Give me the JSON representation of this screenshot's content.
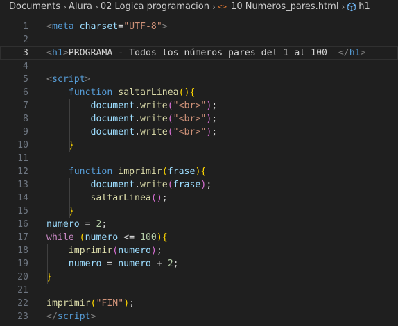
{
  "breadcrumb": {
    "items": [
      "Documents",
      "Alura",
      "02 Logica programacion"
    ],
    "file_icon": "<>",
    "file_name": "10 Numeros_pares.html",
    "symbol_icon": "cube-icon",
    "symbol_name": "h1"
  },
  "editor": {
    "current_line": 3,
    "lines": [
      {
        "n": "1",
        "tokens": [
          [
            "tag",
            "<"
          ],
          [
            "tagname",
            "meta"
          ],
          [
            "plain",
            " "
          ],
          [
            "attr",
            "charset"
          ],
          [
            "plain",
            "="
          ],
          [
            "str",
            "\"UTF-8\""
          ],
          [
            "tag",
            ">"
          ]
        ]
      },
      {
        "n": "2",
        "tokens": []
      },
      {
        "n": "3",
        "tokens": [
          [
            "tag",
            "<"
          ],
          [
            "tagname",
            "h1"
          ],
          [
            "tag",
            ">"
          ],
          [
            "text",
            "PROGRAMA - Todos los números pares del 1 al 100  "
          ],
          [
            "tag",
            "</"
          ],
          [
            "tagname",
            "h1"
          ],
          [
            "tag",
            ">"
          ]
        ]
      },
      {
        "n": "4",
        "tokens": []
      },
      {
        "n": "5",
        "tokens": [
          [
            "tag",
            "<"
          ],
          [
            "tagname",
            "script"
          ],
          [
            "tag",
            ">"
          ]
        ]
      },
      {
        "n": "6",
        "tokens": [
          [
            "plain",
            "    "
          ],
          [
            "kw",
            "function"
          ],
          [
            "plain",
            " "
          ],
          [
            "fn",
            "saltarLinea"
          ],
          [
            "br1",
            "()"
          ],
          [
            "br1",
            "{"
          ]
        ]
      },
      {
        "n": "7",
        "tokens": [
          [
            "plain",
            "        "
          ],
          [
            "var",
            "document"
          ],
          [
            "plain",
            "."
          ],
          [
            "fn",
            "write"
          ],
          [
            "br2",
            "("
          ],
          [
            "str",
            "\"<br>\""
          ],
          [
            "br2",
            ")"
          ],
          [
            "plain",
            ";"
          ]
        ]
      },
      {
        "n": "8",
        "tokens": [
          [
            "plain",
            "        "
          ],
          [
            "var",
            "document"
          ],
          [
            "plain",
            "."
          ],
          [
            "fn",
            "write"
          ],
          [
            "br2",
            "("
          ],
          [
            "str",
            "\"<br>\""
          ],
          [
            "br2",
            ")"
          ],
          [
            "plain",
            ";"
          ]
        ]
      },
      {
        "n": "9",
        "tokens": [
          [
            "plain",
            "        "
          ],
          [
            "var",
            "document"
          ],
          [
            "plain",
            "."
          ],
          [
            "fn",
            "write"
          ],
          [
            "br2",
            "("
          ],
          [
            "str",
            "\"<br>\""
          ],
          [
            "br2",
            ")"
          ],
          [
            "plain",
            ";"
          ]
        ]
      },
      {
        "n": "10",
        "tokens": [
          [
            "plain",
            "    "
          ],
          [
            "br1",
            "}"
          ]
        ]
      },
      {
        "n": "11",
        "tokens": []
      },
      {
        "n": "12",
        "tokens": [
          [
            "plain",
            "    "
          ],
          [
            "kw",
            "function"
          ],
          [
            "plain",
            " "
          ],
          [
            "fn",
            "imprimir"
          ],
          [
            "br1",
            "("
          ],
          [
            "var",
            "frase"
          ],
          [
            "br1",
            ")"
          ],
          [
            "br1",
            "{"
          ]
        ]
      },
      {
        "n": "13",
        "tokens": [
          [
            "plain",
            "        "
          ],
          [
            "var",
            "document"
          ],
          [
            "plain",
            "."
          ],
          [
            "fn",
            "write"
          ],
          [
            "br2",
            "("
          ],
          [
            "var",
            "frase"
          ],
          [
            "br2",
            ")"
          ],
          [
            "plain",
            ";"
          ]
        ]
      },
      {
        "n": "14",
        "tokens": [
          [
            "plain",
            "        "
          ],
          [
            "fn",
            "saltarLinea"
          ],
          [
            "br2",
            "()"
          ],
          [
            "plain",
            ";"
          ]
        ]
      },
      {
        "n": "15",
        "tokens": [
          [
            "plain",
            "    "
          ],
          [
            "br1",
            "}"
          ]
        ]
      },
      {
        "n": "16",
        "tokens": [
          [
            "var",
            "numero"
          ],
          [
            "plain",
            " = "
          ],
          [
            "num",
            "2"
          ],
          [
            "plain",
            ";"
          ]
        ]
      },
      {
        "n": "17",
        "tokens": [
          [
            "kwc",
            "while"
          ],
          [
            "plain",
            " "
          ],
          [
            "br1",
            "("
          ],
          [
            "var",
            "numero"
          ],
          [
            "plain",
            " <= "
          ],
          [
            "num",
            "100"
          ],
          [
            "br1",
            ")"
          ],
          [
            "br1",
            "{"
          ]
        ]
      },
      {
        "n": "18",
        "tokens": [
          [
            "plain",
            "    "
          ],
          [
            "fn",
            "imprimir"
          ],
          [
            "br2",
            "("
          ],
          [
            "var",
            "numero"
          ],
          [
            "br2",
            ")"
          ],
          [
            "plain",
            ";"
          ]
        ]
      },
      {
        "n": "19",
        "tokens": [
          [
            "plain",
            "    "
          ],
          [
            "var",
            "numero"
          ],
          [
            "plain",
            " = "
          ],
          [
            "var",
            "numero"
          ],
          [
            "plain",
            " + "
          ],
          [
            "num",
            "2"
          ],
          [
            "plain",
            ";"
          ]
        ]
      },
      {
        "n": "20",
        "tokens": [
          [
            "br1",
            "}"
          ]
        ]
      },
      {
        "n": "21",
        "tokens": []
      },
      {
        "n": "22",
        "tokens": [
          [
            "fn",
            "imprimir"
          ],
          [
            "br1",
            "("
          ],
          [
            "str",
            "\"FIN\""
          ],
          [
            "br1",
            ")"
          ],
          [
            "plain",
            ";"
          ]
        ]
      },
      {
        "n": "23",
        "tokens": [
          [
            "tag",
            "</"
          ],
          [
            "tagname",
            "script"
          ],
          [
            "tag",
            ">"
          ]
        ]
      }
    ]
  },
  "colors": {
    "background": "#1f1f1f",
    "tag_bracket": "#808080",
    "tag_name": "#569cd6",
    "string": "#ce9178",
    "function": "#dcdcaa",
    "variable": "#9cdcfe",
    "number": "#b5cea8",
    "bracket_level_1": "#ffd700",
    "bracket_level_2": "#da70d6"
  }
}
